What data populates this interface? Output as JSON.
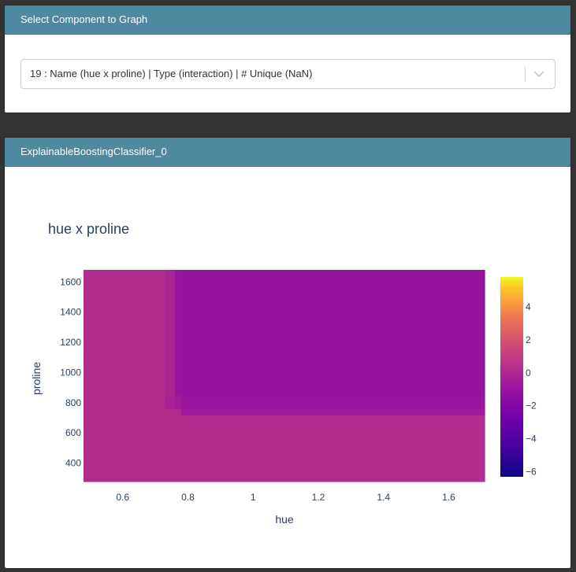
{
  "select_panel": {
    "title": "Select Component to Graph",
    "selected_option": "19 : Name (hue x proline) | Type (interaction) | # Unique (NaN)"
  },
  "graph_panel": {
    "title": "ExplainableBoostingClassifier_0"
  },
  "chart_data": {
    "type": "heatmap",
    "title": "hue x proline",
    "xlabel": "hue",
    "ylabel": "proline",
    "xlim": [
      0.48,
      1.71
    ],
    "ylim": [
      278,
      1680
    ],
    "x_ticks": [
      0.6,
      0.8,
      1,
      1.2,
      1.4,
      1.6
    ],
    "y_ticks": [
      400,
      600,
      800,
      1000,
      1200,
      1400,
      1600
    ],
    "colorscale": "plasma",
    "colorbar": {
      "range": [
        -6.3,
        5.8
      ],
      "ticks": [
        4,
        2,
        0,
        -2,
        -4,
        -6
      ]
    },
    "x_edges": [
      0.48,
      0.6,
      0.69,
      0.73,
      0.76,
      0.78,
      1.71
    ],
    "y_edges": [
      278,
      720,
      760,
      800,
      850,
      1680
    ],
    "z": [
      [
        0.2,
        0.2,
        0.2,
        0.2,
        0.2,
        0.2
      ],
      [
        0.2,
        0.2,
        0.2,
        0.2,
        0.1,
        -0.7
      ],
      [
        0.2,
        0.2,
        0.2,
        -0.3,
        -0.6,
        -1.0
      ],
      [
        0.2,
        0.2,
        0.2,
        -0.4,
        -0.6,
        -1.0
      ],
      [
        0.2,
        0.2,
        0.2,
        -0.1,
        -1.0,
        -1.1
      ]
    ]
  }
}
